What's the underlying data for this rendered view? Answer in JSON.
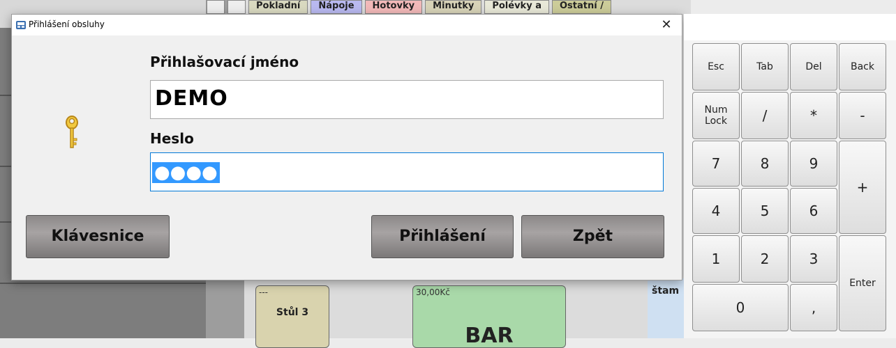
{
  "background": {
    "tabs": [
      "Pokladní",
      "Nápoje",
      "Hotovky",
      "Minutky",
      "Polévky a",
      "Ostatní /"
    ],
    "tab_colors": [
      "#d9d9c0",
      "#b9b9f0",
      "#f2b9b9",
      "#d8d3b8",
      "#e8e8d8",
      "#cccc99"
    ],
    "tiles": [
      {
        "sub": "---",
        "main": "Stůl 3",
        "color": "#d9d3ae"
      },
      {
        "sub": "30,00Kč",
        "main": "BAR",
        "color": "#a9d9a9"
      }
    ],
    "side_note": "štam"
  },
  "dialog": {
    "title": "Přihlášení obsluhy",
    "close": "✕",
    "username_label": "Přihlašovací jméno",
    "username_value": "DEMO",
    "password_label": "Heslo",
    "password_value": "●●●●",
    "buttons": {
      "keyboard": "Klávesnice",
      "login": "Přihlášení",
      "back": "Zpět"
    }
  },
  "keypad": {
    "keys": [
      "Esc",
      "Tab",
      "Del",
      "Back",
      "Num Lock",
      "/",
      "*",
      "-",
      "7",
      "8",
      "9",
      "+",
      "4",
      "5",
      "6",
      "1",
      "2",
      "3",
      "Enter",
      "0",
      ","
    ]
  }
}
